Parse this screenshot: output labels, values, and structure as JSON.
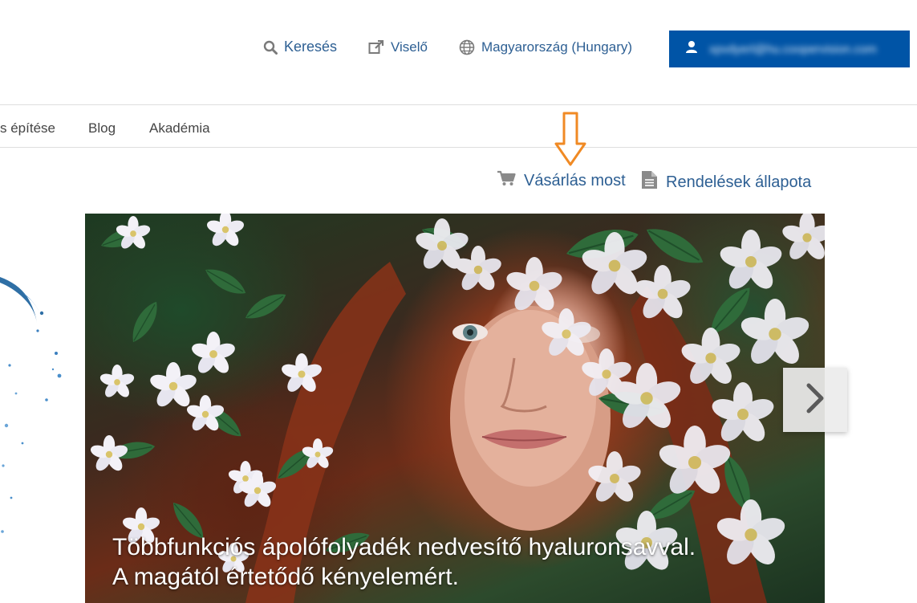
{
  "header": {
    "search_label": "Keresés",
    "reseller_label": "Viselő",
    "region_label": "Magyarország (Hungary)",
    "account_email": "xpvdyerl@hu.coopervision.com"
  },
  "main_nav": {
    "items": [
      {
        "label": "s építése"
      },
      {
        "label": "Blog"
      },
      {
        "label": "Akadémia"
      }
    ]
  },
  "secondary_nav": {
    "shop_now_label": "Vásárlás most",
    "order_status_label": "Rendelések állapota"
  },
  "hero": {
    "caption_line1": "Többfunkciós ápolófolyadék nedvesítő hyaluronsavval.",
    "caption_line2": "A magától értetődő kényelemért."
  },
  "colors": {
    "link": "#2d5f93",
    "account_button": "#0054a6",
    "annotation_arrow": "#f08a24"
  },
  "icons": {
    "search": "search-icon",
    "external_link": "external-link-icon",
    "globe": "globe-icon",
    "user": "user-icon",
    "cart": "cart-icon",
    "document": "document-icon",
    "next": "chevron-right-icon",
    "arrow": "down-arrow-icon"
  }
}
